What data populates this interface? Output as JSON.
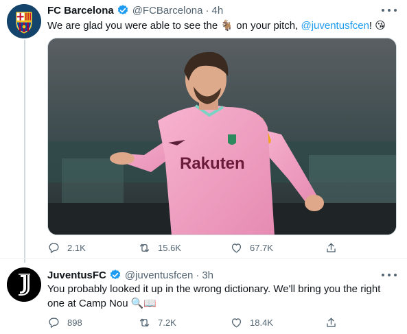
{
  "colors": {
    "text_primary": "#0f1419",
    "text_secondary": "#536471",
    "link": "#1d9bf0",
    "verified_badge": "#1d9bf0",
    "divider": "#eff3f4"
  },
  "tweets": [
    {
      "name": "FC Barcelona",
      "handle": "@FCBarcelona",
      "separator": "·",
      "time": "4h",
      "verified": true,
      "text": {
        "part1": "We are glad you were able to see the ",
        "emoji1": "🐐",
        "part2": " on your pitch, ",
        "mention": "@juventusfcen",
        "part3": "! ",
        "emoji2": "😘"
      },
      "media": {
        "jersey_sponsor": "Rakuten"
      },
      "stats": {
        "replies": "2.1K",
        "retweets": "15.6K",
        "likes": "67.7K"
      },
      "icons": [
        "reply-icon",
        "retweet-icon",
        "like-icon",
        "share-icon",
        "more-icon",
        "verified-icon"
      ]
    },
    {
      "name": "JuventusFC",
      "handle": "@juventusfcen",
      "separator": "·",
      "time": "3h",
      "verified": true,
      "text": {
        "body": "You probably looked it up in the wrong dictionary. We'll bring you the right one at Camp Nou ",
        "emoji": "🔍📖"
      },
      "stats": {
        "replies": "898",
        "retweets": "7.2K",
        "likes": "18.4K"
      }
    }
  ]
}
